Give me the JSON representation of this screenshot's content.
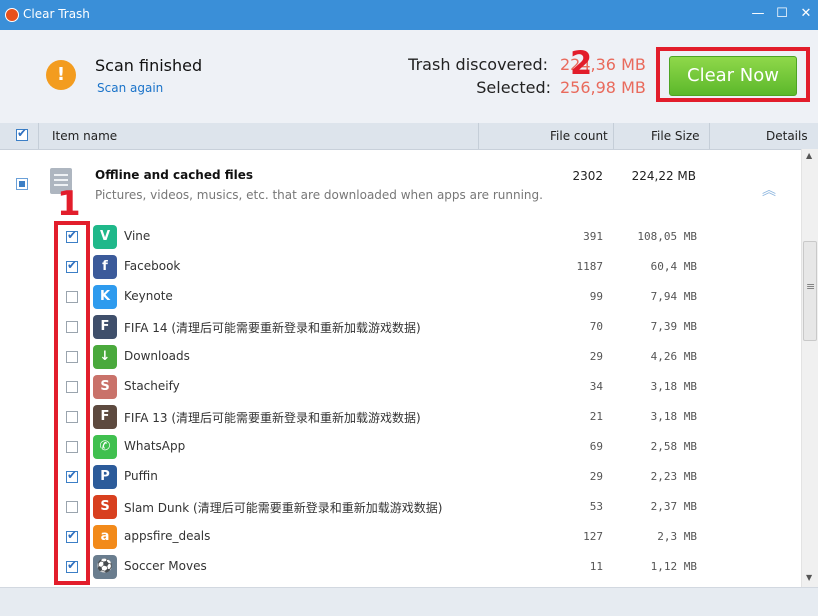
{
  "window": {
    "title": "Clear Trash",
    "min_glyph": "—",
    "max_glyph": "☐",
    "close_glyph": "✕"
  },
  "header": {
    "status": "Scan finished",
    "scan_again": "Scan again",
    "trash_label": "Trash discovered:",
    "trash_value": "224,36 MB",
    "selected_label": "Selected:",
    "selected_value": "256,98 MB",
    "clear_button": "Clear Now",
    "warning_glyph": "!"
  },
  "annotations": {
    "one": "1",
    "two": "2"
  },
  "columns": {
    "item_name": "Item name",
    "file_count": "File count",
    "file_size": "File Size",
    "details": "Details"
  },
  "group": {
    "title": "Offline and cached files",
    "description": "Pictures, videos, musics, etc. that are downloaded when apps are running.",
    "file_count": "2302",
    "file_size": "224,22 MB",
    "collapse_glyph": "︽"
  },
  "apps": [
    {
      "name": "Vine",
      "count": "391",
      "size": "108,05 MB",
      "checked": true,
      "color": "#1fb88a",
      "icon": "vine-icon",
      "glyph": "V"
    },
    {
      "name": "Facebook",
      "count": "1187",
      "size": "60,4 MB",
      "checked": true,
      "color": "#3b5a9a",
      "icon": "facebook-icon",
      "glyph": "f"
    },
    {
      "name": "Keynote",
      "count": "99",
      "size": "7,94 MB",
      "checked": false,
      "color": "#2e9bee",
      "icon": "keynote-icon",
      "glyph": "K"
    },
    {
      "name": "FIFA 14 (清理后可能需要重新登录和重新加载游戏数据)",
      "count": "70",
      "size": "7,39 MB",
      "checked": false,
      "color": "#3f4f6b",
      "icon": "fifa14-icon",
      "glyph": "F"
    },
    {
      "name": "Downloads",
      "count": "29",
      "size": "4,26 MB",
      "checked": false,
      "color": "#4aa93c",
      "icon": "downloads-icon",
      "glyph": "↓"
    },
    {
      "name": "Stacheify",
      "count": "34",
      "size": "3,18 MB",
      "checked": false,
      "color": "#c9726a",
      "icon": "stacheify-icon",
      "glyph": "S"
    },
    {
      "name": "FIFA 13 (清理后可能需要重新登录和重新加载游戏数据)",
      "count": "21",
      "size": "3,18 MB",
      "checked": false,
      "color": "#5d4a3f",
      "icon": "fifa13-icon",
      "glyph": "F"
    },
    {
      "name": "WhatsApp",
      "count": "69",
      "size": "2,58 MB",
      "checked": false,
      "color": "#40c04f",
      "icon": "whatsapp-icon",
      "glyph": "✆"
    },
    {
      "name": "Puffin",
      "count": "29",
      "size": "2,23 MB",
      "checked": true,
      "color": "#2c5b9a",
      "icon": "puffin-icon",
      "glyph": "P"
    },
    {
      "name": "Slam Dunk (清理后可能需要重新登录和重新加载游戏数据)",
      "count": "53",
      "size": "2,37 MB",
      "checked": false,
      "color": "#d8401f",
      "icon": "slamdunk-icon",
      "glyph": "S"
    },
    {
      "name": "appsfire_deals",
      "count": "127",
      "size": "2,3 MB",
      "checked": true,
      "color": "#f28a1a",
      "icon": "appsfire-icon",
      "glyph": "a"
    },
    {
      "name": "Soccer Moves",
      "count": "11",
      "size": "1,12 MB",
      "checked": true,
      "color": "#6a7d8e",
      "icon": "soccermoves-icon",
      "glyph": "⚽"
    }
  ]
}
